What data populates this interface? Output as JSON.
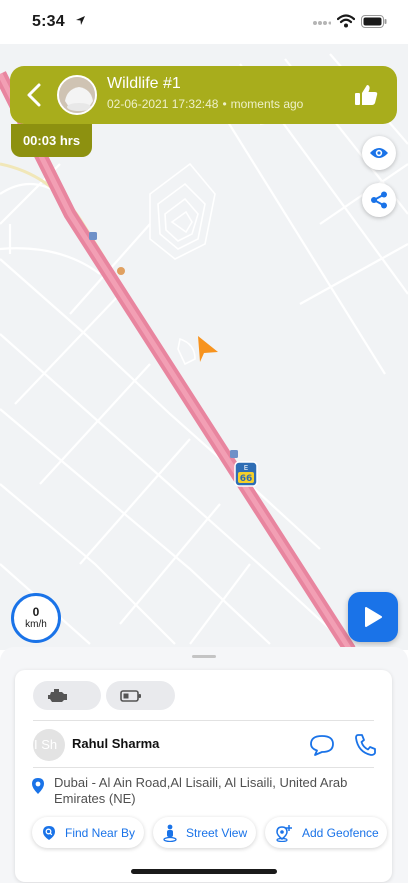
{
  "status_bar": {
    "time": "5:34"
  },
  "header": {
    "title": "Wildlife #1",
    "datetime": "02-06-2021 17:32:48",
    "separator": "•",
    "updated": "moments ago",
    "duration": "00:03 hrs",
    "color": "#a8ad1c"
  },
  "map": {
    "speed_value": "0",
    "speed_unit": "km/h",
    "route_shield": "E 66",
    "route_color": "#e8859f",
    "marker_color": "#f7931e"
  },
  "vehicle": {
    "status_icons": [
      "engine-icon",
      "battery-icon"
    ],
    "driver_initials": "I Sh",
    "driver_name": "Rahul Sharma",
    "address": "Dubai - Al Ain Road,Al Lisaili, Al Lisaili, United Arab Emirates (NE)"
  },
  "actions": {
    "find_near_by": "Find Near By",
    "street_view": "Street View",
    "add_geofence": "Add Geofence"
  },
  "colors": {
    "accent": "#1a73e8"
  }
}
